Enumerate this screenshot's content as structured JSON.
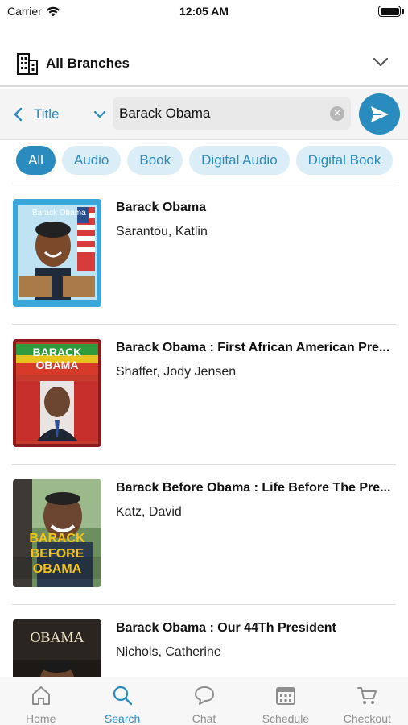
{
  "status_bar": {
    "carrier": "Carrier",
    "time": "12:05 AM"
  },
  "branch": {
    "label": "All Branches"
  },
  "search": {
    "field_type": "Title",
    "query": "Barack Obama"
  },
  "filters": [
    {
      "label": "All",
      "active": true
    },
    {
      "label": "Audio",
      "active": false
    },
    {
      "label": "Book",
      "active": false
    },
    {
      "label": "Digital Audio",
      "active": false
    },
    {
      "label": "Digital Book",
      "active": false
    }
  ],
  "results": [
    {
      "title": "Barack Obama",
      "author": "Sarantou, Katlin",
      "cover_text": "Barack Obama"
    },
    {
      "title": "Barack Obama : First African American Pre...",
      "author": "Shaffer, Jody Jensen",
      "cover_text": "BARACK OBAMA"
    },
    {
      "title": "Barack Before Obama : Life Before The Pre...",
      "author": "Katz, David",
      "cover_text": "BARACK BEFORE OBAMA"
    },
    {
      "title": "Barack Obama : Our 44Th President",
      "author": "Nichols, Catherine",
      "cover_text": "OBAMA"
    }
  ],
  "tabs": [
    {
      "label": "Home",
      "icon": "home-icon"
    },
    {
      "label": "Search",
      "icon": "search-icon",
      "active": true
    },
    {
      "label": "Chat",
      "icon": "chat-icon"
    },
    {
      "label": "Schedule",
      "icon": "calendar-icon"
    },
    {
      "label": "Checkout",
      "icon": "cart-icon"
    }
  ],
  "colors": {
    "accent": "#2a8bbf",
    "chip_bg": "#dbedf6",
    "inactive": "#8e8e8e"
  }
}
